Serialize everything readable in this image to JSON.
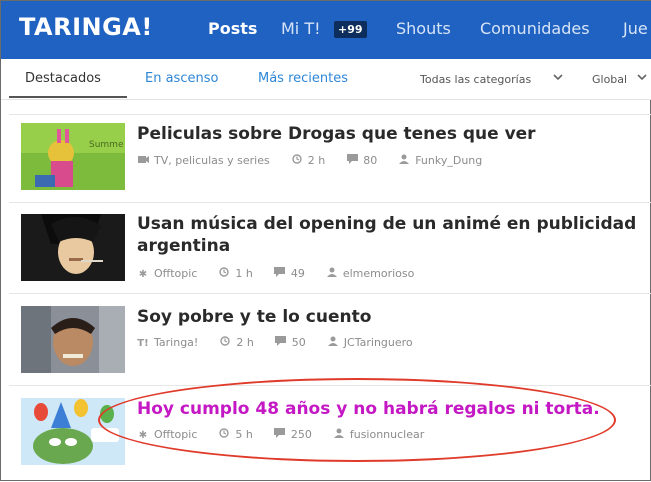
{
  "header": {
    "logo": "TARINGA!",
    "nav": [
      "Posts",
      "Mi T!",
      "Shouts",
      "Comunidades",
      "Jue"
    ],
    "badge": "+99"
  },
  "tabs": [
    "Destacados",
    "En ascenso",
    "Más recientes"
  ],
  "filters": {
    "category": "Todas las categorías",
    "scope": "Global"
  },
  "posts": [
    {
      "title": "Peliculas sobre Drogas que tenes que ver",
      "category": "TV, peliculas y series",
      "time": "2 h",
      "comments": "80",
      "author": "Funky_Dung"
    },
    {
      "title": "Usan música del opening de un animé en publicidad argentina",
      "category": "Offtopic",
      "time": "1 h",
      "comments": "49",
      "author": "elmemorioso"
    },
    {
      "title": "Soy pobre y te lo cuento",
      "category": "Taringa!",
      "time": "2 h",
      "comments": "50",
      "author": "JCTaringuero"
    },
    {
      "title": "Hoy cumplo 48 años y no habrá regalos ni torta.",
      "category": "Offtopic",
      "time": "5 h",
      "comments": "250",
      "author": "fusionnuclear"
    }
  ],
  "colors": {
    "header_bg": "#1f62c2",
    "link": "#2e86d6",
    "highlight_title": "#c418c4",
    "marker": "#e03a2a"
  }
}
